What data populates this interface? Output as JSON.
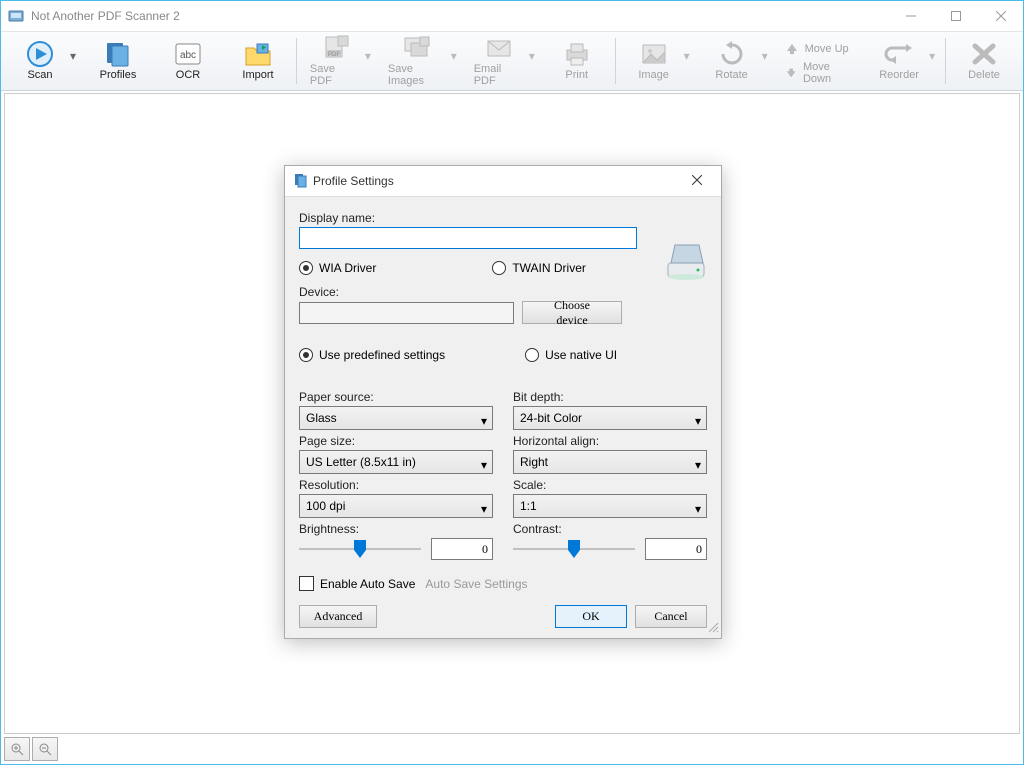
{
  "app": {
    "title": "Not Another PDF Scanner 2"
  },
  "toolbar": {
    "scan": "Scan",
    "profiles": "Profiles",
    "ocr": "OCR",
    "import": "Import",
    "savePdf": "Save PDF",
    "saveImages": "Save Images",
    "emailPdf": "Email PDF",
    "print": "Print",
    "image": "Image",
    "rotate": "Rotate",
    "moveUp": "Move Up",
    "moveDown": "Move Down",
    "reorder": "Reorder",
    "delete": "Delete"
  },
  "dialog": {
    "title": "Profile Settings",
    "displayName": {
      "label": "Display name:",
      "value": ""
    },
    "driver": {
      "wia": "WIA Driver",
      "twain": "TWAIN Driver",
      "selected": "wia"
    },
    "device": {
      "label": "Device:",
      "value": "",
      "choose": "Choose device"
    },
    "settingsMode": {
      "predefined": "Use predefined settings",
      "native": "Use native UI",
      "selected": "predefined"
    },
    "paperSource": {
      "label": "Paper source:",
      "value": "Glass"
    },
    "pageSize": {
      "label": "Page size:",
      "value": "US Letter (8.5x11 in)"
    },
    "resolution": {
      "label": "Resolution:",
      "value": "100 dpi"
    },
    "brightness": {
      "label": "Brightness:",
      "value": "0"
    },
    "bitDepth": {
      "label": "Bit depth:",
      "value": "24-bit Color"
    },
    "hAlign": {
      "label": "Horizontal align:",
      "value": "Right"
    },
    "scale": {
      "label": "Scale:",
      "value": "1:1"
    },
    "contrast": {
      "label": "Contrast:",
      "value": "0"
    },
    "autoSave": {
      "check": "Enable Auto Save",
      "link": "Auto Save Settings"
    },
    "buttons": {
      "advanced": "Advanced",
      "ok": "OK",
      "cancel": "Cancel"
    }
  }
}
